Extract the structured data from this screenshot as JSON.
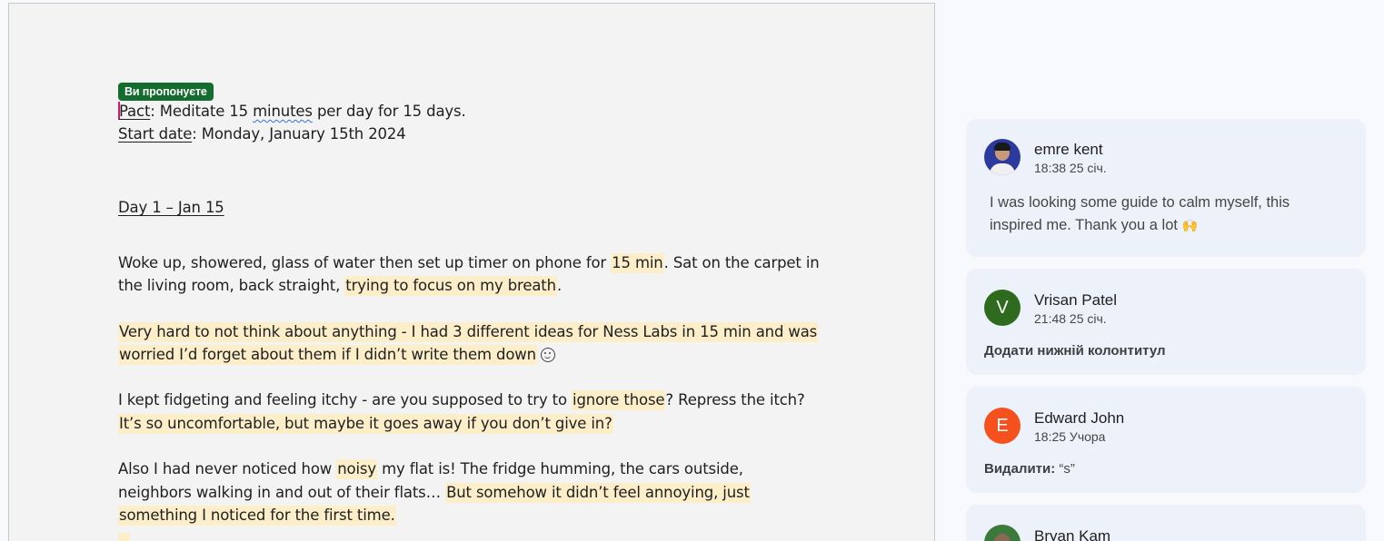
{
  "document": {
    "suggestion_badge": "Ви пропонуєте",
    "pact_label": "Pact",
    "pact_text_1": ": Meditate 15 ",
    "pact_word_minutes": "minutes",
    "pact_text_2": " per day for 15 days.",
    "start_label": "Start date",
    "start_text": ": Monday, January 15th 2024",
    "day_heading": "Day 1 – Jan 15",
    "p1_l1_a": "Woke up, showered, glass of water then set up timer on phone for ",
    "p1_l1_hl": "15 min",
    "p1_l1_b": ". Sat on the carpet in",
    "p1_l2_a": "the living room, back straight, ",
    "p1_l2_hl": "trying to focus on my breath",
    "p1_l2_b": ".",
    "p2_l1": "Very hard to not think about anything - I had 3 different ideas for Ness Labs in 15 min and was",
    "p2_l2": "worried I’d forget about them if I didn’t write them down",
    "p3_l1_a": "I kept fidgeting and feeling itchy - are you supposed to try to ",
    "p3_l1_hl": "ignore those",
    "p3_l1_b": "? Repress the itch?",
    "p3_l2": "It’s so uncomfortable, but maybe it goes away if you don’t give in?",
    "p4_l1_a": "Also I had never noticed how ",
    "p4_l1_hl": "noisy",
    "p4_l1_b": " my flat is! The fridge humming, the cars outside,",
    "p4_l2_a": "neighbors walking in and out of their flats… ",
    "p4_l2_hl": "But somehow it didn’t feel annoying, just",
    "p4_l3": "something I noticed for the first time."
  },
  "comments": [
    {
      "author": "emre kent",
      "time": "18:38 25 січ.",
      "text_1": "I was looking some guide to calm myself, this",
      "text_2": "inspired me. Thank you a lot",
      "emoji": "🙌"
    },
    {
      "author": "Vrisan Patel",
      "initial": "V",
      "time": "21:48 25 січ.",
      "action": "Додати нижній колонтитул",
      "avatar_color": "#2e6b1f"
    },
    {
      "author": "Edward John",
      "initial": "E",
      "time": "18:25 Учора",
      "action_label": "Видалити:",
      "action_value": " “s”",
      "avatar_color": "#f4511e"
    },
    {
      "author": "Bryan Kam"
    }
  ]
}
